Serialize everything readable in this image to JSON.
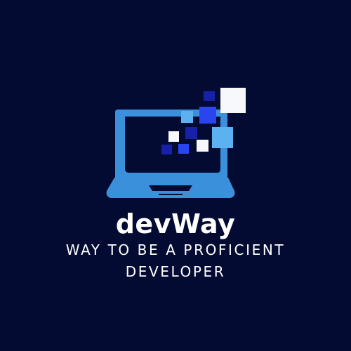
{
  "brand": {
    "name": "devWay",
    "tagline_line1": "WAY TO BE A PROFICIENT",
    "tagline_line2": "DEVELOPER"
  },
  "logo": {
    "icon": "laptop-pixels-icon"
  },
  "colors": {
    "background": "#030b32",
    "laptop": "#3b90dc",
    "accent_dark_blue": "#1621a8",
    "accent_bright_blue": "#2a45f0",
    "accent_light_blue": "#5cb1f0",
    "accent_white": "#f6f8fc",
    "text": "#ffffff"
  }
}
